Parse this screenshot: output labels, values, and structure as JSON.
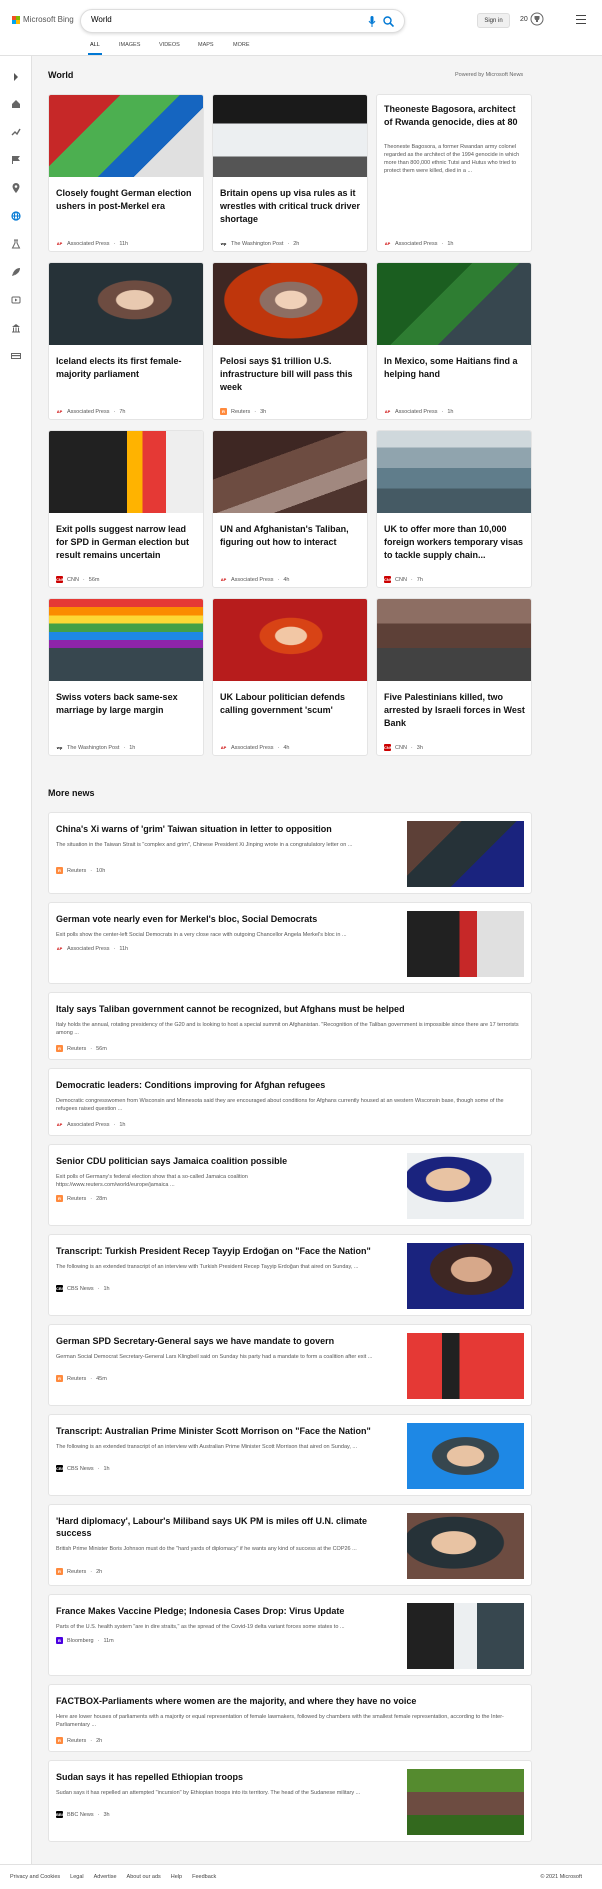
{
  "header": {
    "brand": "Microsoft Bing",
    "search_value": "World",
    "sign_in": "Sign in",
    "rewards_count": "20",
    "tabs": [
      "ALL",
      "IMAGES",
      "VIDEOS",
      "MAPS",
      "MORE"
    ]
  },
  "world": {
    "title": "World",
    "powered_by": "Powered by Microsoft News",
    "cards": [
      {
        "title": "Closely fought German election ushers in post-Merkel era",
        "source": "Associated Press",
        "time": "11h",
        "badge": "AP"
      },
      {
        "title": "Britain opens up visa rules as it wrestles with critical truck driver shortage",
        "source": "The Washington Post",
        "time": "2h",
        "badge": "wp"
      },
      {
        "title": "Theoneste Bagosora, architect of Rwanda genocide, dies at 80",
        "snippet": "Theoneste Bagosora, a former Rwandan army colonel regarded as the architect of the 1994 genocide in which more than 800,000 ethnic Tutsi and Hutus who tried to protect them were killed, died in a ...",
        "source": "Associated Press",
        "time": "1h",
        "badge": "AP"
      },
      {
        "title": "Iceland elects its first female-majority parliament",
        "source": "Associated Press",
        "time": "7h",
        "badge": "AP"
      },
      {
        "title": "Pelosi says $1 trillion U.S. infrastructure bill will pass this week",
        "source": "Reuters",
        "time": "3h",
        "badge": "R"
      },
      {
        "title": "In Mexico, some Haitians find a helping hand",
        "source": "Associated Press",
        "time": "1h",
        "badge": "AP"
      },
      {
        "title": "Exit polls suggest narrow lead for SPD in German election but result remains uncertain",
        "source": "CNN",
        "time": "56m",
        "badge": "CNN"
      },
      {
        "title": "UN and Afghanistan's Taliban, figuring out how to interact",
        "source": "Associated Press",
        "time": "4h",
        "badge": "AP"
      },
      {
        "title": "UK to offer more than 10,000 foreign workers temporary visas to tackle supply chain...",
        "source": "CNN",
        "time": "7h",
        "badge": "CNN"
      },
      {
        "title": "Swiss voters back same-sex marriage by large margin",
        "source": "The Washington Post",
        "time": "1h",
        "badge": "wp"
      },
      {
        "title": "UK Labour politician defends calling government 'scum'",
        "source": "Associated Press",
        "time": "4h",
        "badge": "AP"
      },
      {
        "title": "Five Palestinians killed, two arrested by Israeli forces in West Bank",
        "source": "CNN",
        "time": "3h",
        "badge": "CNN"
      }
    ]
  },
  "more_news": {
    "title": "More news",
    "items": [
      {
        "title": "China's Xi warns of 'grim' Taiwan situation in letter to opposition",
        "snippet": "The situation in the Taiwan Strait is \"complex and grim\", Chinese President Xi Jinping wrote in a congratulatory letter on ...",
        "source": "Reuters",
        "time": "10h",
        "badge": "R"
      },
      {
        "title": "German vote nearly even for Merkel's bloc, Social Democrats",
        "snippet": "Exit polls show the center-left Social Democrats in a very close race with outgoing Chancellor Angela Merkel's bloc in ...",
        "source": "Associated Press",
        "time": "11h",
        "badge": "AP"
      },
      {
        "title": "Italy says Taliban government cannot be recognized, but Afghans must be helped",
        "snippet": "Italy holds the annual, rotating presidency of the G20 and is looking to host a special summit on Afghanistan. \"Recognition of the Taliban government is impossible since there are 17 terrorists among ...",
        "source": "Reuters",
        "time": "56m",
        "badge": "R"
      },
      {
        "title": "Democratic leaders: Conditions improving for Afghan refugees",
        "snippet": "Democratic congresswomen from Wisconsin and Minnesota said they are encouraged about conditions for Afghans currently housed at an western Wisconsin base, though some of the refugees raised question ...",
        "source": "Associated Press",
        "time": "1h",
        "badge": "AP"
      },
      {
        "title": "Senior CDU politician says Jamaica coalition possible",
        "snippet": "Exit polls of Germany's federal election show that a so-called Jamaica coalition https://www.reuters.com/world/europe/jamaica ...",
        "source": "Reuters",
        "time": "28m",
        "badge": "R"
      },
      {
        "title": "Transcript: Turkish President Recep Tayyip Erdoğan on \"Face the Nation\"",
        "snippet": "The following is an extended transcript of an interview with Turkish President Recep Tayyip Erdoğan that aired on Sunday, ...",
        "source": "CBS News",
        "time": "1h",
        "badge": "CBS"
      },
      {
        "title": "German SPD Secretary-General says we have mandate to govern",
        "snippet": "German Social Democrat Secretary-General Lars Klingbeil said on Sunday his party had a mandate to form a coalition after exit ...",
        "source": "Reuters",
        "time": "45m",
        "badge": "R"
      },
      {
        "title": "Transcript: Australian Prime Minister Scott Morrison on \"Face the Nation\"",
        "snippet": "The following is an extended transcript of an interview with Australian Prime Minister Scott Morrison that aired on Sunday, ...",
        "source": "CBS News",
        "time": "1h",
        "badge": "CBS"
      },
      {
        "title": "'Hard diplomacy', Labour's Miliband says UK PM is miles off U.N. climate success",
        "snippet": "British Prime Minister Boris Johnson must do the \"hard yards of diplomacy\" if he wants any kind of success at the COP26 ...",
        "source": "Reuters",
        "time": "2h",
        "badge": "R"
      },
      {
        "title": "France Makes Vaccine Pledge; Indonesia Cases Drop: Virus Update",
        "snippet": "Parts of the U.S. health system \"are in dire straits,\" as the spread of the Covid-19 delta variant forces some states to ...",
        "source": "Bloomberg",
        "time": "11m",
        "badge": "B"
      },
      {
        "title": "FACTBOX-Parliaments where women are the majority, and where they have no voice",
        "snippet": "Here are lower houses of parliaments with a majority or equal representation of female lawmakers, followed by chambers with the smallest female representation, according to the Inter-Parliamentary ...",
        "source": "Reuters",
        "time": "2h",
        "badge": "R"
      },
      {
        "title": "Sudan says it has repelled Ethiopian troops",
        "snippet": "Sudan says it has repelled an attempted \"incursion\" by Ethiopian troops into its territory. The head of the Sudanese military ...",
        "source": "BBC News",
        "time": "3h",
        "badge": "BBC"
      }
    ]
  },
  "footer": {
    "links": [
      "Privacy and Cookies",
      "Legal",
      "Advertise",
      "About our ads",
      "Help",
      "Feedback"
    ],
    "copyright": "© 2021 Microsoft"
  }
}
